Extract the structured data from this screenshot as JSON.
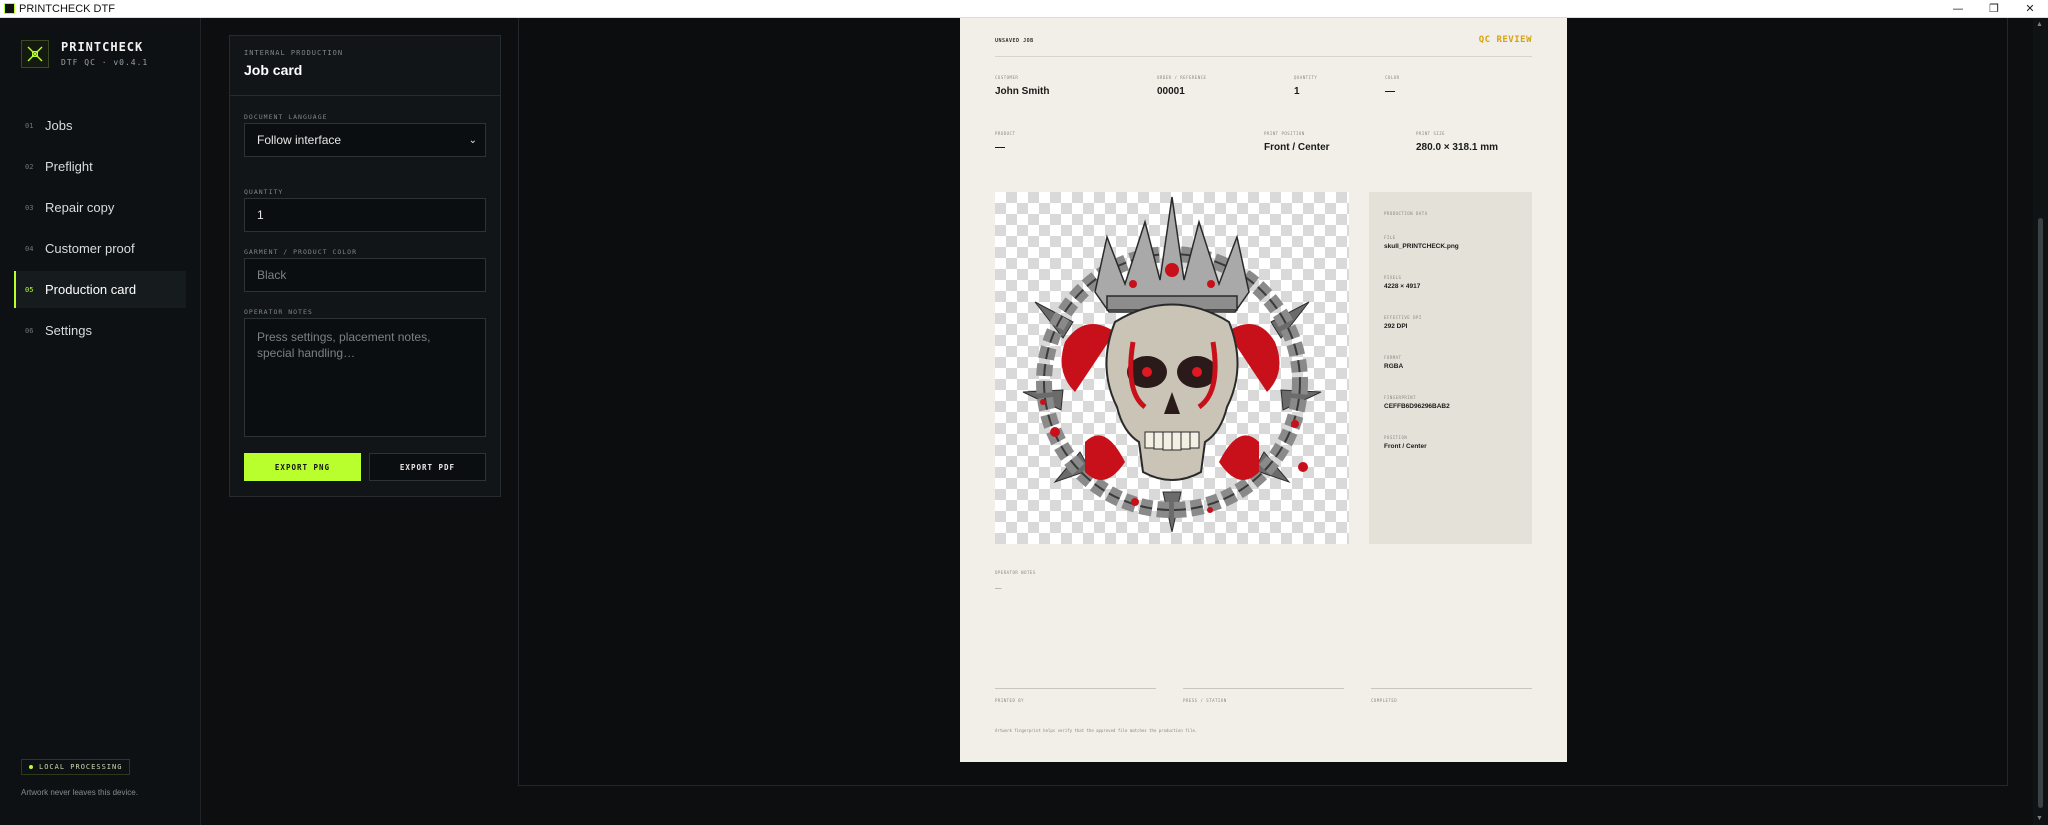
{
  "window": {
    "title": "PRINTCHECK DTF",
    "minimize": "—",
    "maximize": "❐",
    "close": "✕"
  },
  "brand": {
    "name": "PRINTCHECK",
    "subtitle": "DTF QC · v0.4.1"
  },
  "nav": [
    {
      "num": "01",
      "label": "Jobs"
    },
    {
      "num": "02",
      "label": "Preflight"
    },
    {
      "num": "03",
      "label": "Repair copy"
    },
    {
      "num": "04",
      "label": "Customer proof"
    },
    {
      "num": "05",
      "label": "Production card",
      "active": true
    },
    {
      "num": "06",
      "label": "Settings"
    }
  ],
  "footer": {
    "badge": "LOCAL PROCESSING",
    "note": "Artwork never leaves this device."
  },
  "panel": {
    "kicker": "INTERNAL PRODUCTION",
    "title": "Job card",
    "language_label": "DOCUMENT LANGUAGE",
    "language_value": "Follow interface",
    "quantity_label": "QUANTITY",
    "quantity_value": "1",
    "color_label": "GARMENT / PRODUCT COLOR",
    "color_placeholder": "Black",
    "notes_label": "OPERATOR NOTES",
    "notes_placeholder": "Press settings, placement notes, special handling…",
    "export_png": "EXPORT PNG",
    "export_pdf": "EXPORT PDF"
  },
  "sheet": {
    "status": "UNSAVED JOB",
    "badge": "QC REVIEW",
    "customer_label": "CUSTOMER",
    "customer": "John Smith",
    "order_label": "ORDER / REFERENCE",
    "order": "00001",
    "quantity_label": "QUANTITY",
    "quantity": "1",
    "color_label": "COLOR",
    "color": "—",
    "product_label": "PRODUCT",
    "product": "—",
    "position_label": "PRINT POSITION",
    "position": "Front / Center",
    "size_label": "PRINT SIZE",
    "size": "280.0 × 318.1 mm",
    "production": {
      "heading": "PRODUCTION DATA",
      "file_label": "FILE",
      "file": "skull_PRINTCHECK.png",
      "pixels_label": "PIXELS",
      "pixels": "4228 × 4917",
      "dpi_label": "EFFECTIVE DPI",
      "dpi": "292 DPI",
      "format_label": "FORMAT",
      "format": "RGBA",
      "fingerprint_label": "FINGERPRINT",
      "fingerprint": "CEFFB6D96296BAB2",
      "position_label": "POSITION",
      "position": "Front / Center"
    },
    "notes_label": "OPERATOR NOTES",
    "notes": "—",
    "sign_1": "PRINTED BY",
    "sign_2": "PRESS / STATION",
    "sign_3": "COMPLETED",
    "footnote": "Artwork fingerprint helps verify that the approved file matches the production file."
  },
  "colors": {
    "accent": "#b9ff2e",
    "qc_badge": "#d6a217",
    "sheet_bg": "#f1efe7",
    "app_bg": "#0c0e10"
  }
}
